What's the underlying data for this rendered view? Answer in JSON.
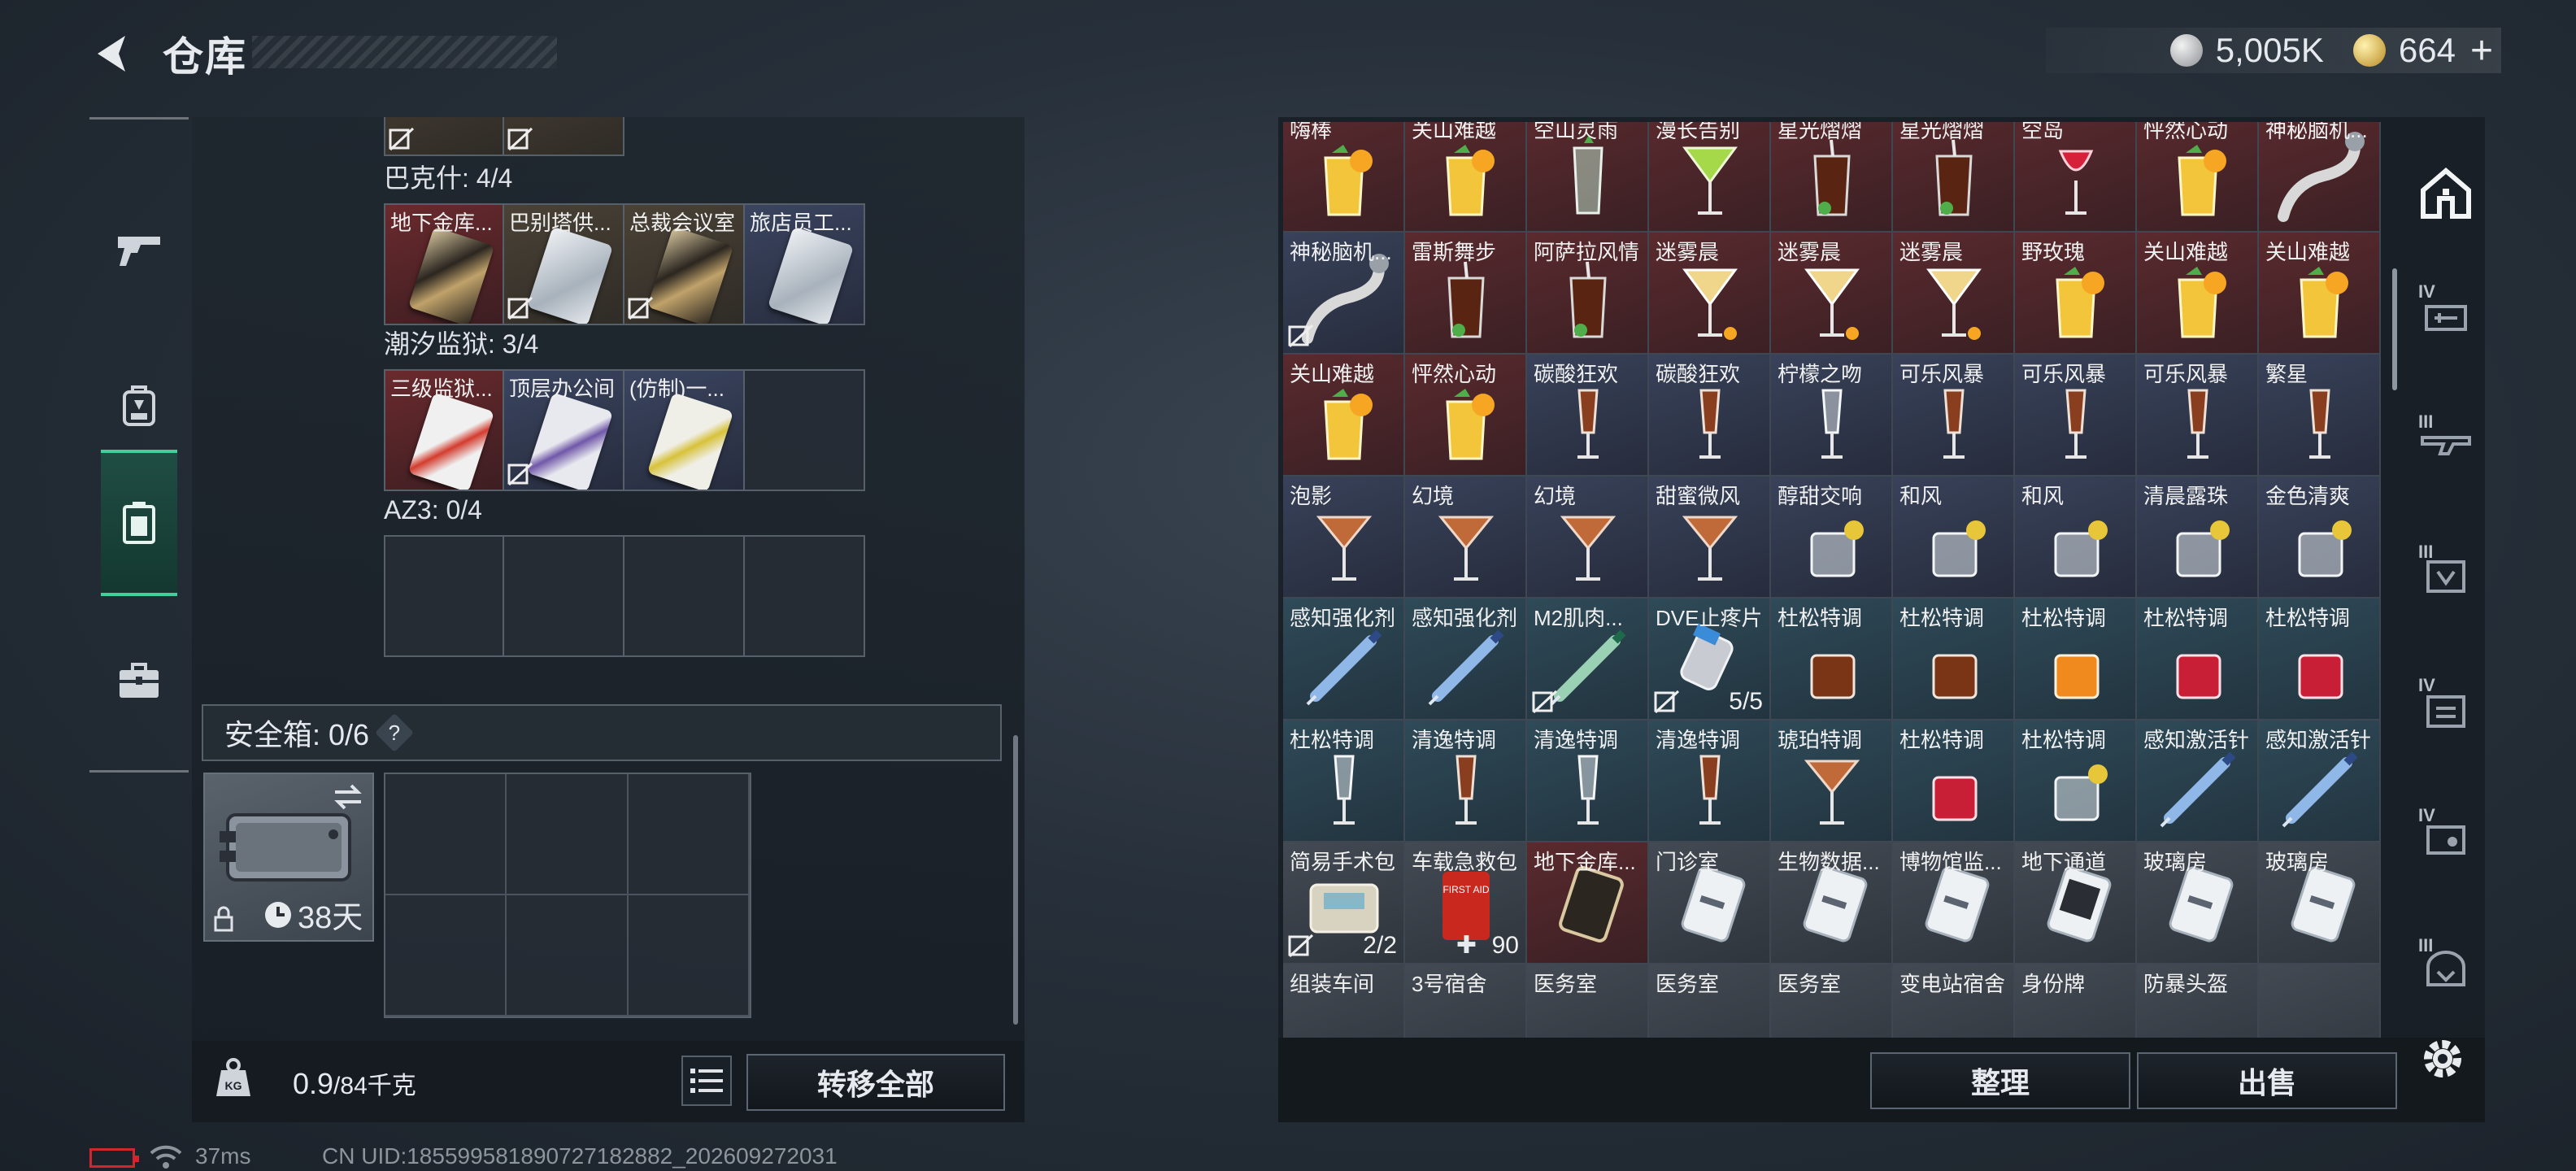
{
  "header": {
    "title": "仓库",
    "currency": [
      {
        "icon": "silver-coin-icon",
        "value": "5,005K"
      },
      {
        "icon": "gold-coin-icon",
        "value": "664"
      }
    ],
    "add_label": "+"
  },
  "left_nav": [
    "gun-icon",
    "backpack-icon",
    "container-icon",
    "briefcase-icon"
  ],
  "key_groups": [
    {
      "label": "巴克什: 4/4",
      "slots": [
        {
          "name": "地下金库...",
          "bg": "red",
          "card": "gold",
          "unbound": false
        },
        {
          "name": "巴别塔供...",
          "bg": "beige",
          "card": "silver",
          "unbound": true
        },
        {
          "name": "总裁会议室",
          "bg": "beige",
          "card": "gold",
          "unbound": true
        },
        {
          "name": "旅店员工...",
          "bg": "blue",
          "card": "silver",
          "unbound": false
        }
      ]
    },
    {
      "label": "潮汐监狱: 3/4",
      "slots": [
        {
          "name": "三级监狱...",
          "bg": "red",
          "card": "red",
          "unbound": false
        },
        {
          "name": "顶层办公间",
          "bg": "blue",
          "card": "purple",
          "unbound": true
        },
        {
          "name": "(仿制)一...",
          "bg": "blue",
          "card": "yellow",
          "unbound": false
        },
        {
          "name": "",
          "bg": "empty",
          "card": "",
          "unbound": false
        }
      ]
    },
    {
      "label": "AZ3: 0/4",
      "slots": [
        {
          "name": "",
          "bg": "empty",
          "card": "",
          "unbound": false
        },
        {
          "name": "",
          "bg": "empty",
          "card": "",
          "unbound": false
        },
        {
          "name": "",
          "bg": "empty",
          "card": "",
          "unbound": false
        },
        {
          "name": "",
          "bg": "empty",
          "card": "",
          "unbound": false
        }
      ]
    }
  ],
  "safe_box": {
    "label": "安全箱: 0/6",
    "help": "?",
    "days": "38天"
  },
  "weight": {
    "current": "0.9",
    "max": "/84千克"
  },
  "transfer_all": "转移全部",
  "inventory": [
    {
      "name": "嗨棒",
      "bg": "red",
      "art": "cocktail-yellow"
    },
    {
      "name": "关山难越",
      "bg": "red",
      "art": "cocktail-yellow"
    },
    {
      "name": "空山灵雨",
      "bg": "red",
      "art": "glass-green"
    },
    {
      "name": "漫长告别",
      "bg": "red",
      "art": "martini-green"
    },
    {
      "name": "星光熠熠",
      "bg": "red",
      "art": "cola"
    },
    {
      "name": "星光熠熠",
      "bg": "red",
      "art": "cola"
    },
    {
      "name": "空岛",
      "bg": "red",
      "art": "wine-red"
    },
    {
      "name": "怦然心动",
      "bg": "red",
      "art": "cocktail-yellow"
    },
    {
      "name": "神秘脑机...",
      "bg": "red",
      "art": "tentacle"
    },
    {
      "name": "神秘脑机...",
      "bg": "blue",
      "art": "tentacle",
      "unbound": true
    },
    {
      "name": "雷斯舞步",
      "bg": "red",
      "art": "cola"
    },
    {
      "name": "阿萨拉风情",
      "bg": "red",
      "art": "cola"
    },
    {
      "name": "迷雾晨",
      "bg": "red",
      "art": "martini-yellow"
    },
    {
      "name": "迷雾晨",
      "bg": "red",
      "art": "martini-yellow"
    },
    {
      "name": "迷雾晨",
      "bg": "red",
      "art": "martini-yellow"
    },
    {
      "name": "野玫瑰",
      "bg": "red",
      "art": "cocktail-yellow"
    },
    {
      "name": "关山难越",
      "bg": "red",
      "art": "cocktail-yellow"
    },
    {
      "name": "关山难越",
      "bg": "red",
      "art": "cocktail-yellow"
    },
    {
      "name": "关山难越",
      "bg": "red",
      "art": "cocktail-yellow"
    },
    {
      "name": "怦然心动",
      "bg": "red",
      "art": "cocktail-yellow"
    },
    {
      "name": "碳酸狂欢",
      "bg": "blue",
      "art": "flute-amber"
    },
    {
      "name": "碳酸狂欢",
      "bg": "blue",
      "art": "flute-amber"
    },
    {
      "name": "柠檬之吻",
      "bg": "blue",
      "art": "flute-clear"
    },
    {
      "name": "可乐风暴",
      "bg": "blue",
      "art": "flute-amber"
    },
    {
      "name": "可乐风暴",
      "bg": "blue",
      "art": "flute-amber"
    },
    {
      "name": "可乐风暴",
      "bg": "blue",
      "art": "flute-amber"
    },
    {
      "name": "繁星",
      "bg": "blue",
      "art": "flute-amber"
    },
    {
      "name": "泡影",
      "bg": "blue",
      "art": "martini-red"
    },
    {
      "name": "幻境",
      "bg": "blue",
      "art": "martini-red"
    },
    {
      "name": "幻境",
      "bg": "blue",
      "art": "martini-red"
    },
    {
      "name": "甜蜜微风",
      "bg": "blue",
      "art": "martini-red"
    },
    {
      "name": "醇甜交响",
      "bg": "blue",
      "art": "rocks-clear"
    },
    {
      "name": "和风",
      "bg": "blue",
      "art": "rocks-clear"
    },
    {
      "name": "和风",
      "bg": "blue",
      "art": "rocks-clear"
    },
    {
      "name": "清晨露珠",
      "bg": "blue",
      "art": "rocks-clear"
    },
    {
      "name": "金色清爽",
      "bg": "blue",
      "art": "rocks-clear"
    },
    {
      "name": "感知强化剂",
      "bg": "teal",
      "art": "syringe"
    },
    {
      "name": "感知强化剂",
      "bg": "teal",
      "art": "syringe"
    },
    {
      "name": "M2肌肉...",
      "bg": "teal",
      "art": "syringe-green",
      "unbound": true
    },
    {
      "name": "DVE止疼片",
      "bg": "teal",
      "art": "pill",
      "qty": "5/5",
      "unbound": true
    },
    {
      "name": "杜松特调",
      "bg": "teal",
      "art": "rocks-amber"
    },
    {
      "name": "杜松特调",
      "bg": "teal",
      "art": "rocks-amber"
    },
    {
      "name": "杜松特调",
      "bg": "teal",
      "art": "rocks-orange"
    },
    {
      "name": "杜松特调",
      "bg": "teal",
      "art": "rocks-red"
    },
    {
      "name": "杜松特调",
      "bg": "teal",
      "art": "rocks-red"
    },
    {
      "name": "杜松特调",
      "bg": "teal",
      "art": "flute-clear"
    },
    {
      "name": "清逸特调",
      "bg": "teal",
      "art": "flute-amber"
    },
    {
      "name": "清逸特调",
      "bg": "teal",
      "art": "flute-clear"
    },
    {
      "name": "清逸特调",
      "bg": "teal",
      "art": "flute-amber"
    },
    {
      "name": "琥珀特调",
      "bg": "teal",
      "art": "martini-red"
    },
    {
      "name": "杜松特调",
      "bg": "teal",
      "art": "rocks-red"
    },
    {
      "name": "杜松特调",
      "bg": "teal",
      "art": "rocks-clear"
    },
    {
      "name": "感知激活针",
      "bg": "teal",
      "art": "syringe"
    },
    {
      "name": "感知激活针",
      "bg": "teal",
      "art": "syringe"
    },
    {
      "name": "简易手术包",
      "bg": "gray",
      "art": "medkit",
      "qty": "2/2",
      "unbound": true
    },
    {
      "name": "车载急救包",
      "bg": "gray",
      "art": "redbag",
      "qty": "90",
      "heal": true
    },
    {
      "name": "地下金库...",
      "bg": "red",
      "art": "card-gold"
    },
    {
      "name": "门诊室",
      "bg": "gray",
      "art": "card-silver"
    },
    {
      "name": "生物数据...",
      "bg": "gray",
      "art": "card-silver"
    },
    {
      "name": "博物馆监...",
      "bg": "gray",
      "art": "card-silver"
    },
    {
      "name": "地下通道",
      "bg": "gray",
      "art": "card-dark"
    },
    {
      "name": "玻璃房",
      "bg": "gray",
      "art": "card-silver"
    },
    {
      "name": "玻璃房",
      "bg": "gray",
      "art": "card-silver"
    },
    {
      "name": "组装车间",
      "bg": "gray",
      "art": "none"
    },
    {
      "name": "3号宿舍",
      "bg": "gray",
      "art": "none"
    },
    {
      "name": "医务室",
      "bg": "gray",
      "art": "none"
    },
    {
      "name": "医务室",
      "bg": "gray",
      "art": "none"
    },
    {
      "name": "医务室",
      "bg": "gray",
      "art": "none"
    },
    {
      "name": "变电站宿舍",
      "bg": "gray",
      "art": "none"
    },
    {
      "name": "身份牌",
      "bg": "gray",
      "art": "none"
    },
    {
      "name": "防暴头盔",
      "bg": "gray",
      "art": "none"
    },
    {
      "name": "",
      "bg": "gray",
      "art": "none"
    }
  ],
  "organize": "整理",
  "sell": "出售",
  "right_nav": [
    {
      "icon": "house-icon",
      "roman": ""
    },
    {
      "icon": "gun-case-icon",
      "roman": "IV"
    },
    {
      "icon": "rifle-icon",
      "roman": "III"
    },
    {
      "icon": "armor-icon",
      "roman": "III"
    },
    {
      "icon": "bag-icon",
      "roman": "IV"
    },
    {
      "icon": "chest-rig-icon",
      "roman": "IV"
    },
    {
      "icon": "helmet-icon",
      "roman": "III"
    }
  ],
  "status": {
    "ping": "37ms",
    "uid": "CN UID:18559958189072718288​2_202609272031"
  }
}
